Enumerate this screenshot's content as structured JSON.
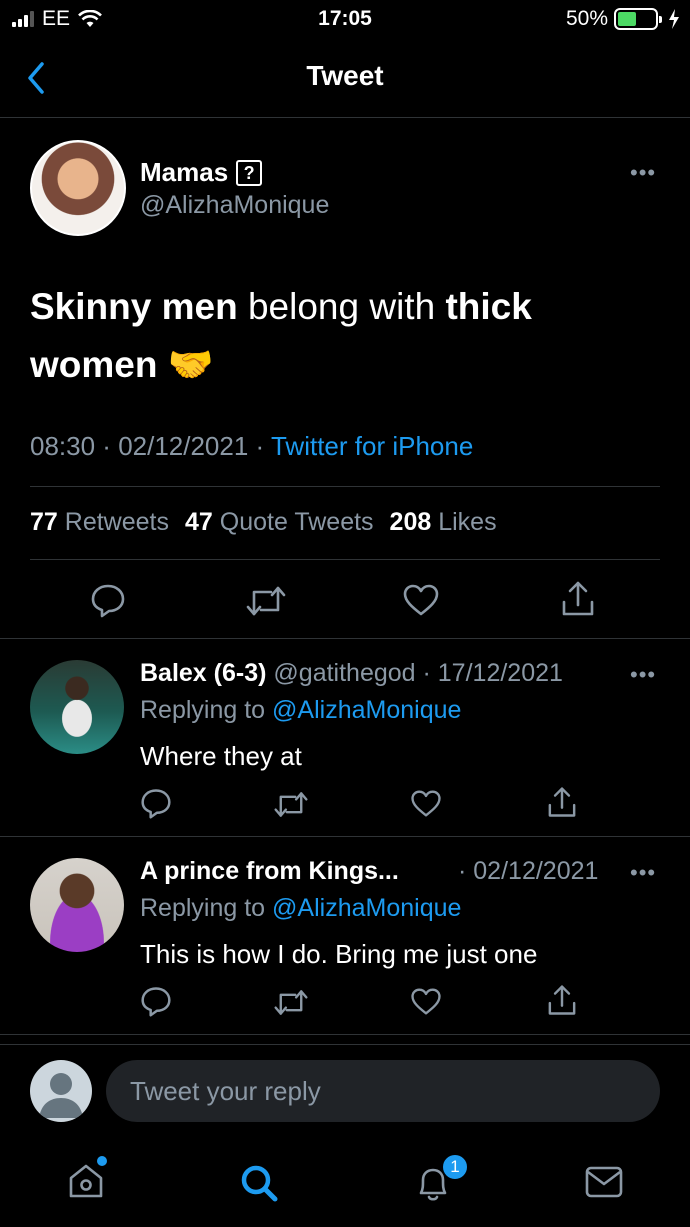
{
  "status_bar": {
    "carrier": "EE",
    "time": "17:05",
    "battery": "50%",
    "battery_level": 0.5
  },
  "nav": {
    "title": "Tweet"
  },
  "tweet": {
    "display_name": "Mamas",
    "badge": "?",
    "handle": "@AlizhaMonique",
    "text_parts": [
      "Skinny men",
      " belong with ",
      "thick women",
      " 🤝"
    ],
    "time": "08:30",
    "date": "02/12/2021",
    "source": "Twitter for iPhone",
    "retweets_count": "77",
    "retweets_label": "Retweets",
    "quotes_count": "47",
    "quotes_label": "Quote Tweets",
    "likes_count": "208",
    "likes_label": "Likes"
  },
  "replies": [
    {
      "name": "Balex (6-3)",
      "handle": "@gatithegod",
      "date": "17/12/2021",
      "replying_label": "Replying to",
      "replying_to": "@AlizhaMonique",
      "text": "Where they at"
    },
    {
      "name": "A prince from Kings...",
      "handle": "",
      "date": "02/12/2021",
      "replying_label": "Replying to",
      "replying_to": "@AlizhaMonique",
      "text": "This is how I do. Bring me just one"
    }
  ],
  "composer": {
    "placeholder": "Tweet your reply"
  },
  "tabbar": {
    "notification_count": "1"
  },
  "colors": {
    "accent": "#1d9bf0",
    "secondary_text": "#8b98a5",
    "divider": "#2f3336",
    "battery": "#4cd964"
  }
}
